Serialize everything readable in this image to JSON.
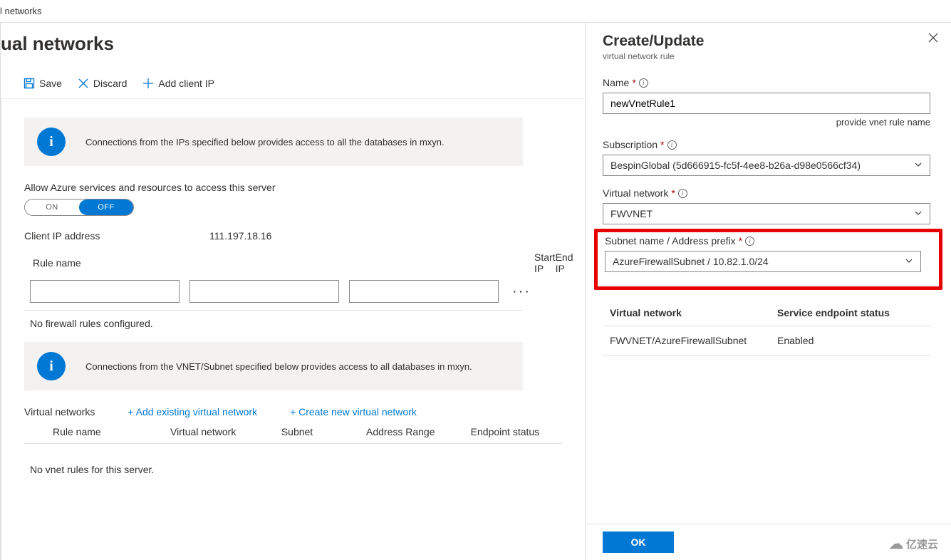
{
  "breadcrumb": "l networks",
  "page_title": "ual networks",
  "toolbar": {
    "save": "Save",
    "discard": "Discard",
    "add_client_ip": "Add client IP"
  },
  "info1": "Connections from the IPs specified below provides access to all the databases in mxyn.",
  "allow_azure_label": "Allow Azure services and resources to access this server",
  "toggle": {
    "on": "ON",
    "off": "OFF"
  },
  "client_ip": {
    "label": "Client IP address",
    "value": "111.197.18.16"
  },
  "fw_cols": {
    "rule": "Rule name",
    "start": "Start IP",
    "end": "End IP"
  },
  "fw_row": {
    "rule": "",
    "start": "",
    "end": ""
  },
  "no_fw": "No firewall rules configured.",
  "info2": "Connections from the VNET/Subnet specified below provides access to all databases in mxyn.",
  "vnet_section": {
    "label": "Virtual networks",
    "add_existing": "+ Add existing virtual network",
    "create_new": "+ Create new virtual network"
  },
  "vnet_cols": [
    "Rule name",
    "Virtual network",
    "Subnet",
    "Address Range",
    "Endpoint status"
  ],
  "no_vnet": "No vnet rules for this server.",
  "panel": {
    "title": "Create/Update",
    "subtitle": "virtual network rule",
    "name_label": "Name",
    "name_value": "newVnetRule1",
    "name_hint": "provide vnet rule name",
    "sub_label": "Subscription",
    "sub_value": "BespinGlobal (5d666915-fc5f-4ee8-b26a-d98e0566cf34)",
    "vnet_label": "Virtual network",
    "vnet_value": "FWVNET",
    "subnet_label": "Subnet name / Address prefix",
    "subnet_value": "AzureFirewallSubnet / 10.82.1.0/24",
    "tbl_h1": "Virtual network",
    "tbl_h2": "Service endpoint status",
    "tbl_v1": "FWVNET/AzureFirewallSubnet",
    "tbl_v2": "Enabled",
    "ok": "OK"
  },
  "watermark": "亿速云"
}
